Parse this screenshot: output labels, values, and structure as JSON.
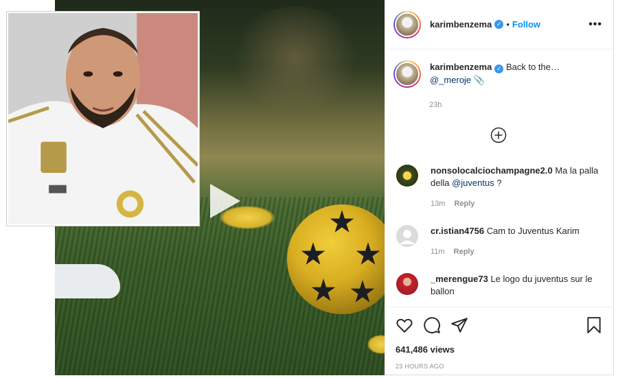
{
  "post": {
    "username": "karimbenzema",
    "follow_label": "Follow",
    "dot": "•",
    "more": "•••",
    "verified_icon": "check-icon",
    "caption_text": "Back to the…",
    "caption_mention": "@_meroje",
    "caption_emoji": "📎",
    "caption_time": "23h",
    "views": "641,486 views",
    "posted": "23 HOURS AGO"
  },
  "comments": [
    {
      "username": "nonsolocalciochampagne2.0",
      "text_before": "Ma la palla della",
      "mention": "@juventus",
      "text_after": " ?",
      "time": "13m",
      "reply": "Reply"
    },
    {
      "username": "cr.istian4756",
      "text": "Cam to Juventus Karim",
      "time": "11m",
      "reply": "Reply"
    },
    {
      "username": "_merengue73",
      "text": "Le logo du juventus sur le ballon"
    }
  ],
  "icons": {
    "like": "heart-icon",
    "comment": "comment-icon",
    "share": "share-icon",
    "save": "bookmark-icon",
    "play": "play-icon",
    "load_more": "plus-circle-icon"
  },
  "colors": {
    "link": "#0095f6",
    "mention": "#00376b",
    "muted": "#8e8e8e",
    "verified": "#3897f0"
  }
}
